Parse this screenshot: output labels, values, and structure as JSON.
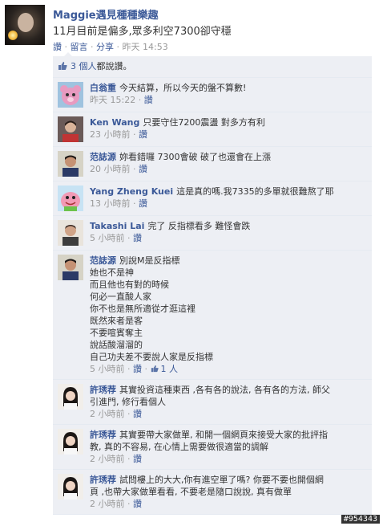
{
  "post": {
    "author": "Maggie遇見種種樂趣",
    "text": "11月目前是偏多,眾多利空7300卻守穩",
    "actions": {
      "like": "讚",
      "comment": "留言",
      "share": "分享",
      "sep": "·",
      "time": "昨天 14:53"
    }
  },
  "likes": {
    "text_link": "3 個人",
    "text_rest": "都說讚。"
  },
  "comments": [
    {
      "name": "白翁重",
      "lines": [
        "今天結算，所以今天的盤不算數!"
      ],
      "time": "昨天 15:22",
      "like": "讚"
    },
    {
      "name": "Ken Wang",
      "lines": [
        "只要守住7200震盪 對多方有利"
      ],
      "time": "23 小時前",
      "like": "讚"
    },
    {
      "name": "范誌源",
      "lines": [
        "妳看錯囉 7300會破 破了也還會在上漲"
      ],
      "time": "20 小時前",
      "like": "讚"
    },
    {
      "name": "Yang Zheng Kuei",
      "lines": [
        "這是真的嗎.我7335的多單就很難熬了耶"
      ],
      "time": "13 小時前",
      "like": "讚"
    },
    {
      "name": "Takashi Lai",
      "lines": [
        "完了 反指標看多 難怪會跌"
      ],
      "time": "5 小時前",
      "like": "讚"
    },
    {
      "name": "范誌源",
      "lines": [
        "別說M是反指標",
        "她也不是神",
        "而且他也有對的時候",
        "何必一直酸人家",
        "你不也是無所適從才逛這裡",
        "既然來者是客",
        "不要喧賓奪主",
        "說話酸溜溜的",
        "自己功夫差不要說人家是反指標"
      ],
      "time": "5 小時前",
      "like": "讚",
      "like_count": "1 人"
    },
    {
      "name": "許琇荐",
      "lines": [
        "其實投資這種東西 ,各有各的說法, 各有各的方法, 師父",
        "引進門, 修行看個人"
      ],
      "time": "2 小時前",
      "like": "讚"
    },
    {
      "name": "許琇荐",
      "lines": [
        "其實要帶大家做單, 和開一個網頁來接受大家的批評指",
        "教, 真的不容易, 在心情上需要做很適當的調解"
      ],
      "time": "2 小時前",
      "like": "讚"
    },
    {
      "name": "許琇荐",
      "lines": [
        "試問樓上的大大,你有進空單了嗎? 你要不要也開個網",
        "頁 ,也帶大家做單看看, 不要老是隨口說說, 真有做單"
      ],
      "time": "2 小時前",
      "like": "讚"
    }
  ],
  "watermark": "#954343",
  "colors": {
    "link": "#3b5998",
    "meta": "#999999",
    "comment_bg": "#edeff4"
  }
}
